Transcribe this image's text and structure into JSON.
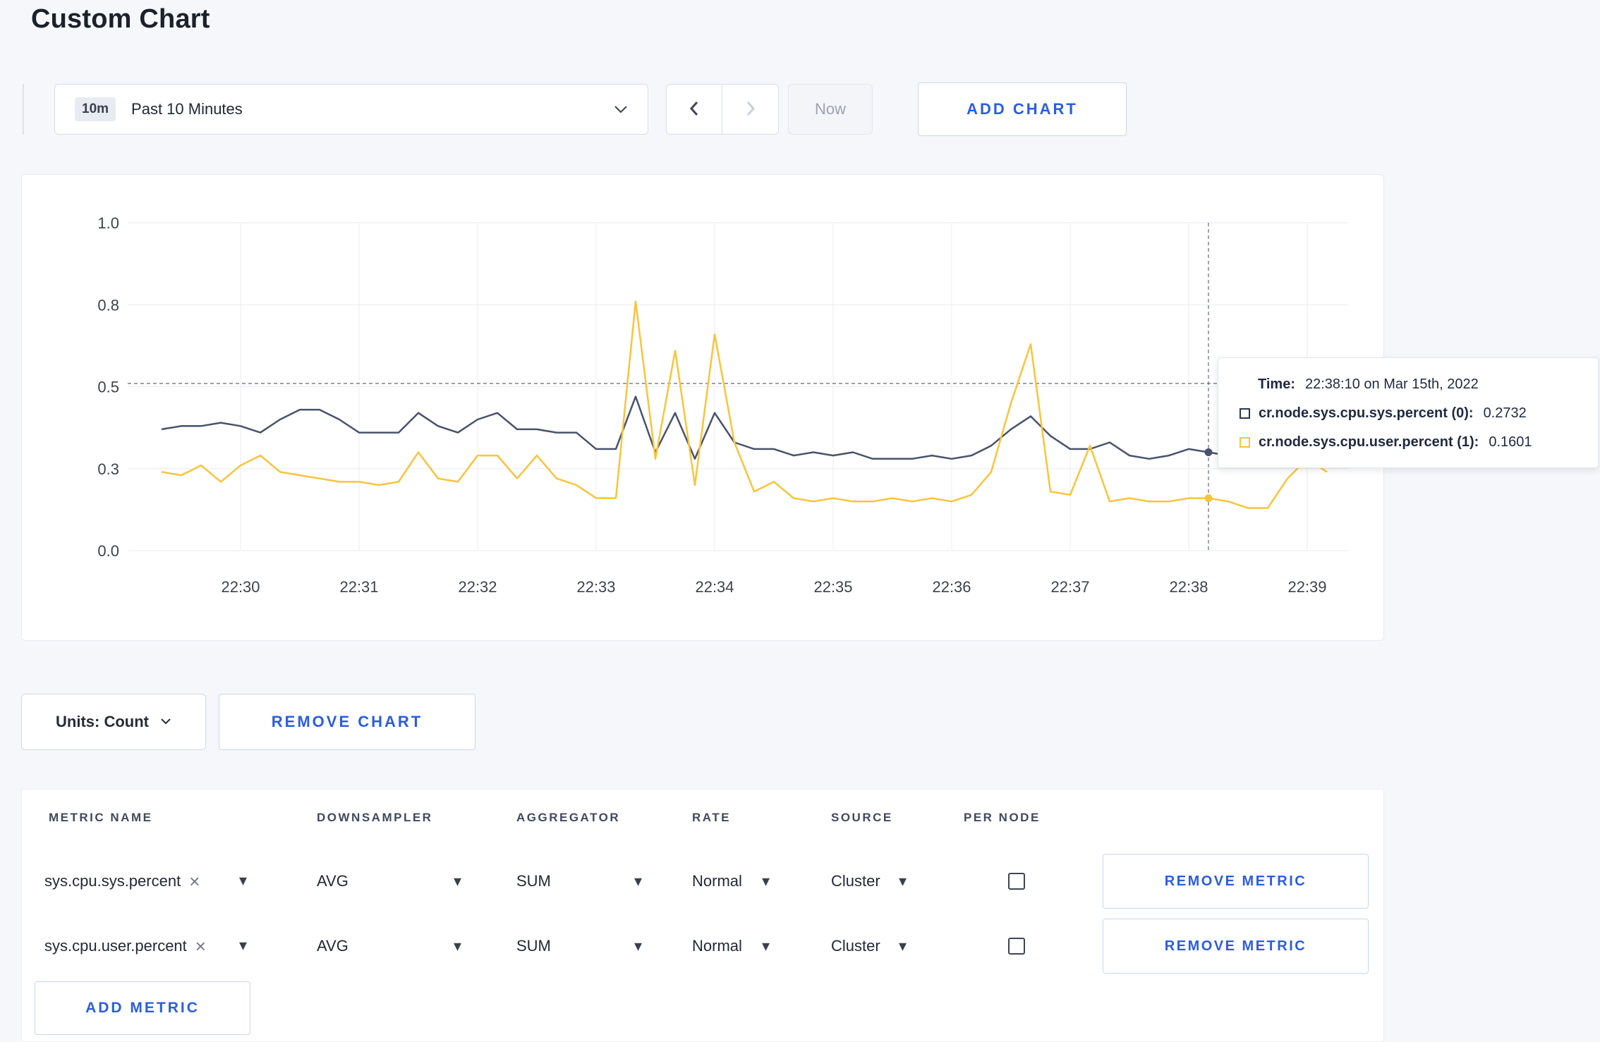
{
  "page": {
    "title": "Custom Chart"
  },
  "colors": {
    "accent_blue": "#2c5de0",
    "series_sys": "#47536b",
    "series_user": "#f9c43c",
    "page_bg": "#f6f7fa"
  },
  "icons": {
    "caret_down": "▾",
    "close": "×"
  },
  "toolbar": {
    "time_badge": "10m",
    "time_label": "Past 10 Minutes",
    "now_label": "Now",
    "add_chart_label": "ADD CHART"
  },
  "tooltip": {
    "time_label": "Time:",
    "time_value": "22:38:10 on Mar 15th, 2022",
    "rows": [
      {
        "label": "cr.node.sys.cpu.sys.percent (0):",
        "value": "0.2732"
      },
      {
        "label": "cr.node.sys.cpu.user.percent (1):",
        "value": "0.1601"
      }
    ]
  },
  "chart_controls": {
    "units_label": "Units: Count",
    "remove_chart_label": "REMOVE CHART"
  },
  "metrics_table": {
    "headers": [
      "METRIC NAME",
      "DOWNSAMPLER",
      "AGGREGATOR",
      "RATE",
      "SOURCE",
      "PER NODE"
    ],
    "rows": [
      {
        "metric": "sys.cpu.sys.percent",
        "downsampler": "AVG",
        "aggregator": "SUM",
        "rate": "Normal",
        "source": "Cluster",
        "per_node_checked": false,
        "remove_label": "REMOVE METRIC"
      },
      {
        "metric": "sys.cpu.user.percent",
        "downsampler": "AVG",
        "aggregator": "SUM",
        "rate": "Normal",
        "source": "Cluster",
        "per_node_checked": false,
        "remove_label": "REMOVE METRIC"
      }
    ],
    "add_metric_label": "ADD METRIC"
  },
  "chart_data": {
    "type": "line",
    "title": "",
    "x_tick_labels": [
      "22:30",
      "22:31",
      "22:32",
      "22:33",
      "22:34",
      "22:35",
      "22:36",
      "22:37",
      "22:38",
      "22:39"
    ],
    "y_tick_values": [
      0,
      0.25,
      0.5,
      0.75,
      1.0
    ],
    "y_tick_labels": [
      "0.0",
      "0.3",
      "0.5",
      "0.8",
      "1.0"
    ],
    "ylim": [
      0,
      1
    ],
    "points_interval_seconds": 10,
    "x_start_label": "22:29:20",
    "threshold_value": 0.51,
    "crosshair_index": 53,
    "crosshair_time": "22:38:10",
    "legend_position": "tooltip",
    "grid": true,
    "series": [
      {
        "name": "cr.node.sys.cpu.sys.percent",
        "color": "#47536b",
        "values": [
          0.37,
          0.38,
          0.38,
          0.39,
          0.38,
          0.36,
          0.4,
          0.43,
          0.43,
          0.4,
          0.36,
          0.36,
          0.36,
          0.42,
          0.38,
          0.36,
          0.4,
          0.42,
          0.37,
          0.37,
          0.36,
          0.36,
          0.31,
          0.31,
          0.47,
          0.3,
          0.42,
          0.28,
          0.42,
          0.33,
          0.31,
          0.31,
          0.29,
          0.3,
          0.29,
          0.3,
          0.28,
          0.28,
          0.28,
          0.29,
          0.28,
          0.29,
          0.32,
          0.37,
          0.41,
          0.35,
          0.31,
          0.31,
          0.33,
          0.29,
          0.28,
          0.29,
          0.31,
          0.3,
          0.29,
          0.29,
          0.32,
          0.3,
          0.3,
          0.31
        ]
      },
      {
        "name": "cr.node.sys.cpu.user.percent",
        "color": "#f9c43c",
        "values": [
          0.24,
          0.23,
          0.26,
          0.21,
          0.26,
          0.29,
          0.24,
          0.23,
          0.22,
          0.21,
          0.21,
          0.2,
          0.21,
          0.3,
          0.22,
          0.21,
          0.29,
          0.29,
          0.22,
          0.29,
          0.22,
          0.2,
          0.16,
          0.16,
          0.76,
          0.28,
          0.61,
          0.2,
          0.66,
          0.33,
          0.18,
          0.21,
          0.16,
          0.15,
          0.16,
          0.15,
          0.15,
          0.16,
          0.15,
          0.16,
          0.15,
          0.17,
          0.24,
          0.45,
          0.63,
          0.18,
          0.17,
          0.32,
          0.15,
          0.16,
          0.15,
          0.15,
          0.16,
          0.16,
          0.15,
          0.13,
          0.13,
          0.22,
          0.28,
          0.24
        ]
      }
    ]
  }
}
